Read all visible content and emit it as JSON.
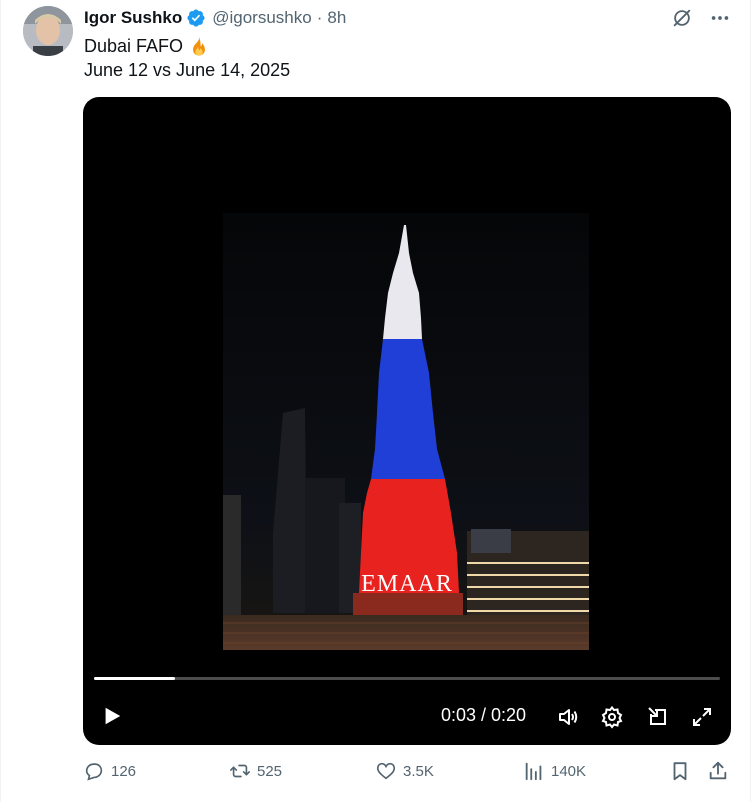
{
  "post": {
    "author_name": "Igor Sushko",
    "author_handle": "@igorsushko",
    "separator": "·",
    "timestamp": "8h",
    "text_line1": "Dubai FAFO",
    "text_line2": "June 12 vs June 14, 2025",
    "emoji": "fire-emoji",
    "verified": true
  },
  "video": {
    "overlay_text": "EMAAR",
    "current_time": "0:03",
    "duration": "0:20",
    "time_display": "0:03 / 0:20",
    "progress_fraction": 0.13,
    "tower_colors": [
      "#e8e8ee",
      "#1f3fd6",
      "#e8231f"
    ]
  },
  "actions": {
    "replies": "126",
    "reposts": "525",
    "likes": "3.5K",
    "views": "140K"
  },
  "colors": {
    "text_primary": "#0f1419",
    "text_secondary": "#536471",
    "verified_blue": "#1d9bf0"
  },
  "icons": [
    "grok-icon",
    "more-icon",
    "play-icon",
    "volume-icon",
    "settings-icon",
    "dock-icon",
    "fullscreen-icon",
    "reply-icon",
    "repost-icon",
    "like-icon",
    "views-icon",
    "bookmark-icon",
    "share-icon"
  ]
}
